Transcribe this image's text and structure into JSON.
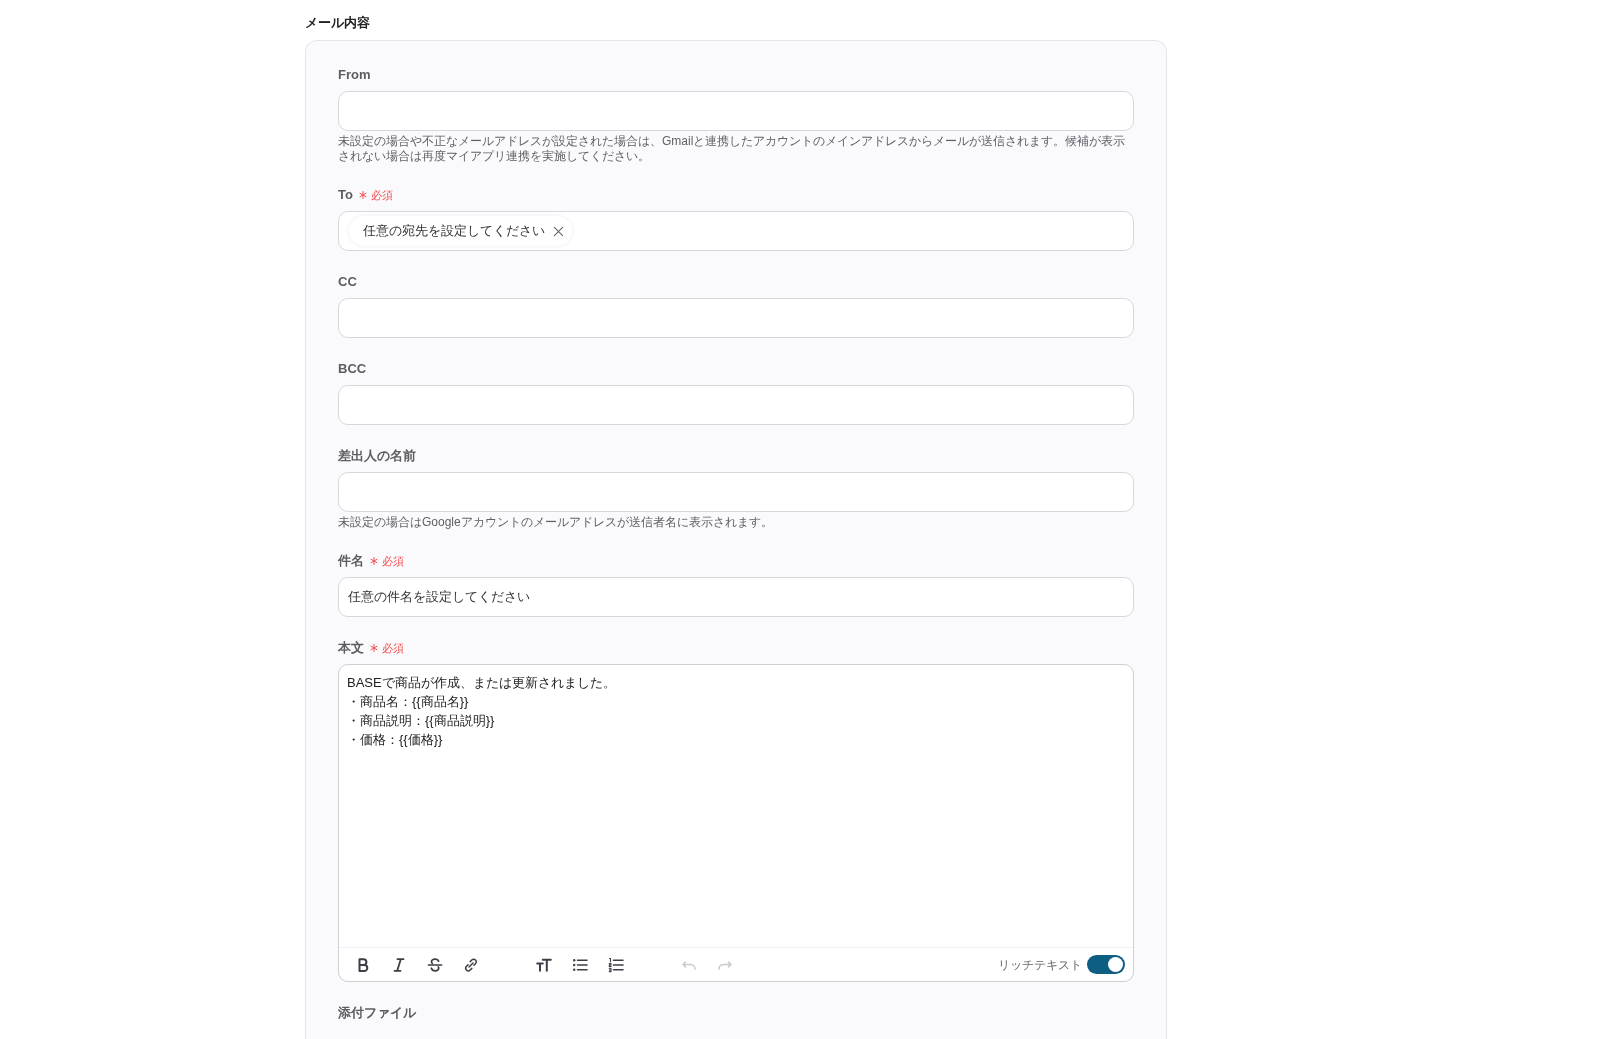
{
  "section_title": "メール内容",
  "fields": [
    {
      "kind": "text",
      "label": "From",
      "required": false,
      "hint": "未設定の場合や不正なメールアドレスが設定された場合は、Gmailと連携したアカウントのメインアドレスからメールが送信されます。候補が表示されない場合は再度マイアプリ連携を実施してください。"
    },
    {
      "kind": "tags",
      "label": "To",
      "required": true,
      "required_label": "必須",
      "tags": [
        "任意の宛先を設定してください"
      ]
    },
    {
      "kind": "text",
      "label": "CC",
      "required": false
    },
    {
      "kind": "text",
      "label": "BCC",
      "required": false
    },
    {
      "kind": "text",
      "label": "差出人の名前",
      "required": false,
      "hint": "未設定の場合はGoogleアカウントのメールアドレスが送信者名に表示されます。"
    },
    {
      "kind": "text",
      "label": "件名",
      "required": true,
      "required_label": "必須",
      "value": "任意の件名を設定してください"
    },
    {
      "kind": "editor",
      "label": "本文",
      "required": true,
      "required_label": "必須",
      "lines": [
        "BASEで商品が作成、または更新されました。",
        "・商品名：{{商品名}}",
        "・商品説明：{{商品説明}}",
        "・価格：{{価格}}"
      ],
      "toolbar": [
        {
          "buttons": [
            {
              "kind": "bold",
              "disabled": false
            },
            {
              "kind": "italic",
              "disabled": false
            },
            {
              "kind": "strikethrough",
              "disabled": false
            },
            {
              "kind": "link",
              "disabled": false
            }
          ]
        },
        {
          "buttons": [
            {
              "kind": "text_size",
              "disabled": false
            },
            {
              "kind": "bullet_list",
              "disabled": false
            },
            {
              "kind": "numbered_list",
              "disabled": false
            }
          ]
        },
        {
          "buttons": [
            {
              "kind": "undo",
              "disabled": true
            },
            {
              "kind": "redo",
              "disabled": true
            }
          ]
        }
      ],
      "rich_text": {
        "label": "リッチテキスト",
        "on": true
      }
    },
    {
      "kind": "attachment",
      "label": "添付ファイル",
      "required": false
    }
  ]
}
